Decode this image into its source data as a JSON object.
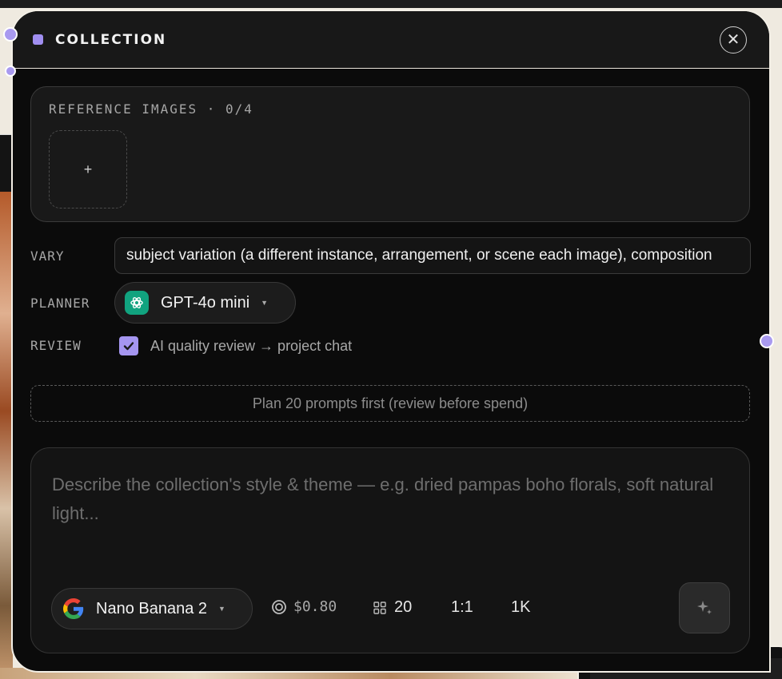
{
  "panel": {
    "title": "COLLECTION",
    "close_label": "✕"
  },
  "reference": {
    "label": "REFERENCE IMAGES · 0/4",
    "add_label": "+"
  },
  "vary": {
    "label": "VARY",
    "value": "subject variation (a different instance, arrangement, or scene each image), composition"
  },
  "planner": {
    "label": "PLANNER",
    "model": "GPT-4o mini",
    "icon": "openai-icon"
  },
  "review": {
    "label": "REVIEW",
    "checked": true,
    "text": "AI quality review → project chat"
  },
  "plan_button": {
    "label": "Plan 20 prompts first (review before spend)"
  },
  "prompt": {
    "placeholder": "Describe the collection's style & theme — e.g. dried pampas boho florals, soft natural light..."
  },
  "generation": {
    "model": "Nano Banana 2",
    "model_icon": "google-icon",
    "cost": "$0.80",
    "count": "20",
    "aspect_ratio": "1:1",
    "resolution": "1K"
  },
  "colors": {
    "accent": "#a596f0",
    "openai_green": "#11a37f"
  }
}
